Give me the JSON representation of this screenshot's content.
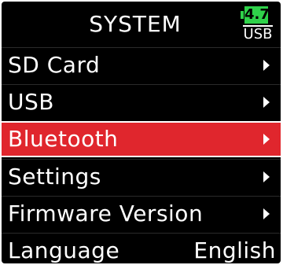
{
  "header": {
    "title": "SYSTEM",
    "battery_level": "4.7",
    "power_source": "USB",
    "battery_color": "#2fd24a"
  },
  "menu": {
    "items": [
      {
        "label": "SD Card",
        "has_submenu": true,
        "selected": false
      },
      {
        "label": "USB",
        "has_submenu": true,
        "selected": false
      },
      {
        "label": "Bluetooth",
        "has_submenu": true,
        "selected": true
      },
      {
        "label": "Settings",
        "has_submenu": true,
        "selected": false
      },
      {
        "label": "Firmware Version",
        "has_submenu": true,
        "selected": false
      },
      {
        "label": "Language",
        "has_submenu": false,
        "selected": false,
        "value": "English"
      }
    ],
    "selected_color": "#e0262d"
  }
}
